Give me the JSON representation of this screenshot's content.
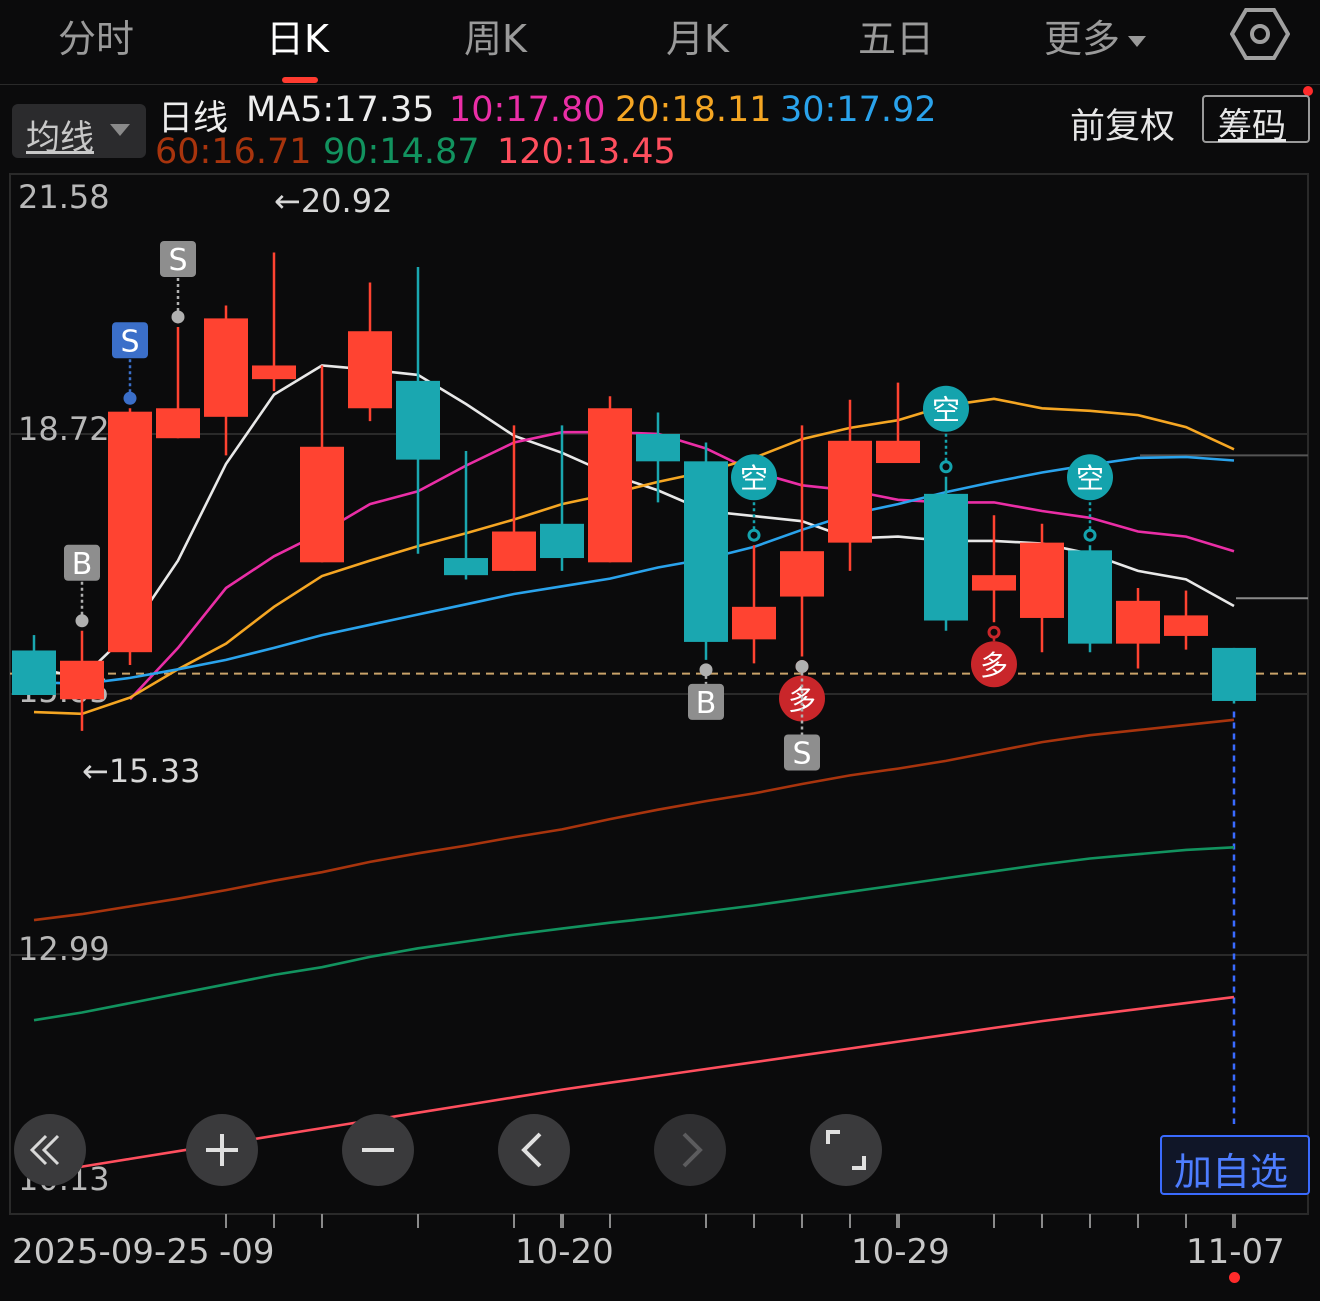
{
  "tabs": [
    "分时",
    "日K",
    "周K",
    "月K",
    "五日",
    "更多"
  ],
  "active_tab": "日K",
  "ma_button": "均线",
  "legend": {
    "day": "日线",
    "ma5": "MA5:17.35",
    "ma10": "10:17.80",
    "ma20": "20:18.11",
    "ma30": "30:17.92",
    "ma60": "60:16.71",
    "ma90": "90:14.87",
    "ma120": "120:13.45"
  },
  "right_controls": {
    "adjust": "前复权",
    "chips": "筹码"
  },
  "add_watch": "加自选",
  "colors": {
    "up": "#ff4331",
    "down": "#1aa7b0",
    "ma5": "#e8e8e8",
    "ma10": "#ea2ea6",
    "ma20": "#f5a623",
    "ma30": "#2aa3ec",
    "ma60": "#a8340d",
    "ma90": "#12935f",
    "ma120": "#ff4f5e",
    "background": "#0b0b0c"
  },
  "chart_data": {
    "type": "candlestick",
    "y_ticks": [
      "21.58",
      "18.72",
      "15.85",
      "12.99",
      "10.13"
    ],
    "ylim": [
      10.13,
      21.58
    ],
    "x_labels": [
      "2025-09-25",
      "-09",
      "10-20",
      "10-29",
      "11-07"
    ],
    "high_annotation": "←20.92",
    "low_annotation": "←15.33",
    "reference_price": 16.0,
    "candles": [
      {
        "o": 16.27,
        "h": 16.45,
        "l": 15.75,
        "c": 15.75
      },
      {
        "o": 15.7,
        "h": 16.5,
        "l": 15.33,
        "c": 16.15
      },
      {
        "o": 16.25,
        "h": 19.1,
        "l": 16.1,
        "c": 19.06
      },
      {
        "o": 18.75,
        "h": 20.05,
        "l": 18.75,
        "c": 19.1
      },
      {
        "o": 19.0,
        "h": 20.3,
        "l": 18.55,
        "c": 20.15
      },
      {
        "o": 19.44,
        "h": 20.92,
        "l": 19.3,
        "c": 19.6
      },
      {
        "o": 17.3,
        "h": 19.6,
        "l": 17.3,
        "c": 18.65
      },
      {
        "o": 19.1,
        "h": 20.57,
        "l": 18.95,
        "c": 20.0
      },
      {
        "o": 19.42,
        "h": 20.75,
        "l": 17.4,
        "c": 18.5
      },
      {
        "o": 17.35,
        "h": 18.6,
        "l": 17.1,
        "c": 17.15
      },
      {
        "o": 17.2,
        "h": 18.9,
        "l": 17.2,
        "c": 17.66
      },
      {
        "o": 17.75,
        "h": 18.9,
        "l": 17.2,
        "c": 17.35
      },
      {
        "o": 17.3,
        "h": 19.24,
        "l": 17.3,
        "c": 19.1
      },
      {
        "o": 18.8,
        "h": 19.05,
        "l": 18.0,
        "c": 18.48
      },
      {
        "o": 18.48,
        "h": 18.7,
        "l": 16.16,
        "c": 16.37
      },
      {
        "o": 16.4,
        "h": 17.5,
        "l": 16.12,
        "c": 16.78
      },
      {
        "o": 16.9,
        "h": 18.9,
        "l": 16.2,
        "c": 17.43
      },
      {
        "o": 17.53,
        "h": 19.2,
        "l": 17.2,
        "c": 18.72
      },
      {
        "o": 18.46,
        "h": 19.4,
        "l": 18.46,
        "c": 18.72
      },
      {
        "o": 18.1,
        "h": 18.3,
        "l": 16.5,
        "c": 16.62
      },
      {
        "o": 16.97,
        "h": 17.85,
        "l": 16.6,
        "c": 17.15
      },
      {
        "o": 16.65,
        "h": 17.75,
        "l": 16.25,
        "c": 17.53
      },
      {
        "o": 17.44,
        "h": 17.5,
        "l": 16.25,
        "c": 16.35
      },
      {
        "o": 16.35,
        "h": 17.0,
        "l": 16.06,
        "c": 16.85
      },
      {
        "o": 16.44,
        "h": 16.97,
        "l": 16.28,
        "c": 16.68
      },
      {
        "o": 16.3,
        "h": 16.3,
        "l": 15.65,
        "c": 15.68
      }
    ],
    "series": [
      {
        "name": "MA5",
        "values": [
          16.07,
          15.95,
          16.49,
          17.32,
          18.45,
          19.26,
          19.6,
          19.55,
          19.49,
          19.15,
          18.78,
          18.58,
          18.33,
          18.14,
          17.9,
          17.84,
          17.78,
          17.58,
          17.6,
          17.55,
          17.55,
          17.52,
          17.4,
          17.2,
          17.1,
          16.79
        ]
      },
      {
        "name": "MA10",
        "values": [
          null,
          null,
          15.7,
          16.3,
          17.0,
          17.37,
          17.65,
          17.98,
          18.13,
          18.43,
          18.7,
          18.82,
          18.82,
          18.8,
          18.63,
          18.36,
          18.2,
          18.14,
          18.03,
          18.0,
          18.0,
          17.9,
          17.82,
          17.66,
          17.6,
          17.43
        ]
      },
      {
        "name": "MA20",
        "values": [
          15.55,
          15.53,
          15.72,
          16.05,
          16.35,
          16.78,
          17.14,
          17.32,
          17.49,
          17.64,
          17.8,
          17.98,
          18.1,
          18.24,
          18.36,
          18.52,
          18.74,
          18.87,
          18.96,
          19.13,
          19.21,
          19.1,
          19.07,
          19.02,
          18.88,
          18.62
        ]
      },
      {
        "name": "MA30",
        "values": [
          15.9,
          15.88,
          15.95,
          16.05,
          16.16,
          16.3,
          16.45,
          16.57,
          16.69,
          16.81,
          16.93,
          17.02,
          17.11,
          17.24,
          17.34,
          17.48,
          17.68,
          17.86,
          17.98,
          18.12,
          18.24,
          18.35,
          18.44,
          18.52,
          18.53,
          18.49
        ]
      },
      {
        "name": "MA60",
        "values": [
          13.12,
          13.19,
          13.28,
          13.37,
          13.47,
          13.58,
          13.68,
          13.8,
          13.9,
          13.99,
          14.09,
          14.18,
          14.3,
          14.41,
          14.51,
          14.6,
          14.71,
          14.81,
          14.89,
          14.98,
          15.09,
          15.2,
          15.28,
          15.34,
          15.4,
          15.46
        ]
      },
      {
        "name": "MA90",
        "values": [
          11.95,
          12.04,
          12.15,
          12.26,
          12.37,
          12.48,
          12.57,
          12.69,
          12.79,
          12.87,
          12.95,
          13.02,
          13.09,
          13.15,
          13.22,
          13.29,
          13.37,
          13.45,
          13.53,
          13.61,
          13.69,
          13.77,
          13.84,
          13.89,
          13.94,
          13.97
        ]
      },
      {
        "name": "MA120",
        "values": [
          10.15,
          10.24,
          10.33,
          10.42,
          10.51,
          10.6,
          10.69,
          10.78,
          10.87,
          10.96,
          11.05,
          11.14,
          11.22,
          11.3,
          11.38,
          11.46,
          11.54,
          11.62,
          11.7,
          11.78,
          11.86,
          11.94,
          12.01,
          12.08,
          12.15,
          12.22
        ]
      }
    ],
    "signals": [
      {
        "i": 1,
        "label": "B",
        "pos": "above",
        "style": "gray"
      },
      {
        "i": 2,
        "label": "S",
        "pos": "above",
        "style": "blue"
      },
      {
        "i": 3,
        "label": "S",
        "pos": "above",
        "style": "gray"
      },
      {
        "i": 14,
        "label": "B",
        "pos": "below",
        "style": "gray"
      },
      {
        "i": 15,
        "label": "空",
        "pos": "above",
        "style": "teal"
      },
      {
        "i": 16,
        "label": "多",
        "pos": "below",
        "style": "red"
      },
      {
        "i": 16,
        "label": "S",
        "pos": "below2",
        "style": "gray"
      },
      {
        "i": 19,
        "label": "空",
        "pos": "above",
        "style": "teal"
      },
      {
        "i": 20,
        "label": "多",
        "pos": "below",
        "style": "red"
      },
      {
        "i": 22,
        "label": "空",
        "pos": "above",
        "style": "teal"
      }
    ]
  }
}
